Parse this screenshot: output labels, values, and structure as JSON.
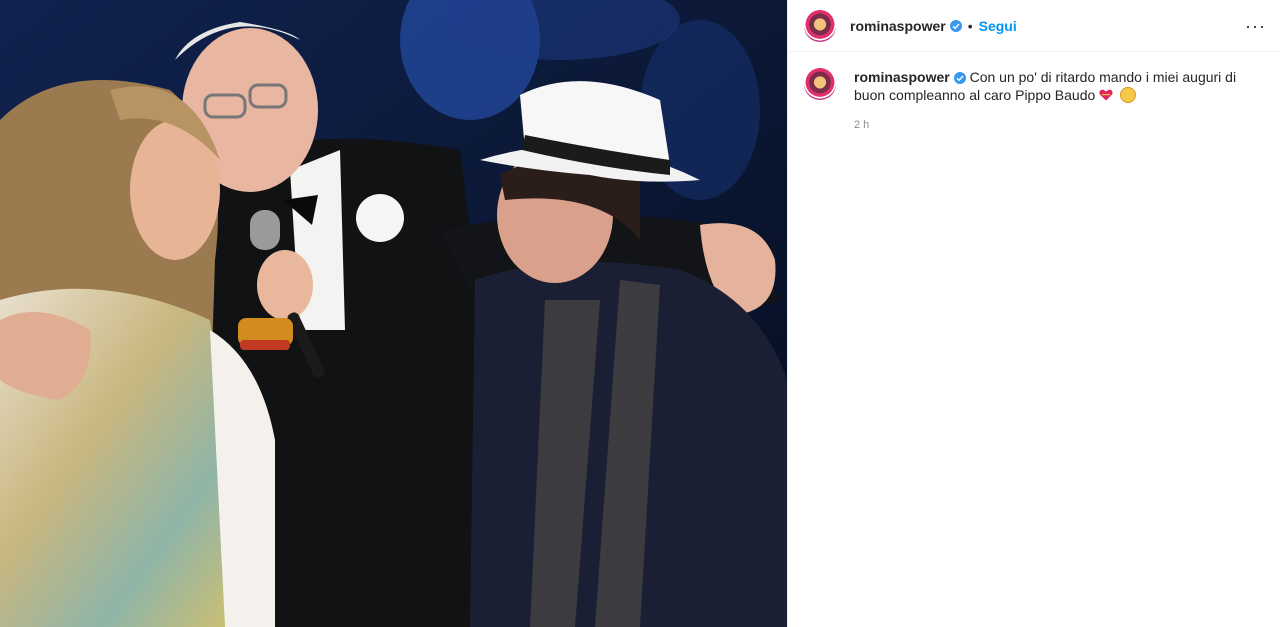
{
  "post": {
    "username": "rominaspower",
    "follow_label": "Segui",
    "separator": "•",
    "more_label": "···",
    "caption_text": "Con un po' di ritardo mando i miei auguri di buon compleanno al caro Pippo Baudo",
    "time": "2 h"
  },
  "icons": {
    "verified": "verified-badge-icon",
    "more": "more-options-icon",
    "heart": "heart-emoji",
    "smile": "smiling-hug-emoji"
  },
  "colors": {
    "link": "#0095f6",
    "verified": "#3897f0",
    "muted": "#8e8e8e"
  }
}
